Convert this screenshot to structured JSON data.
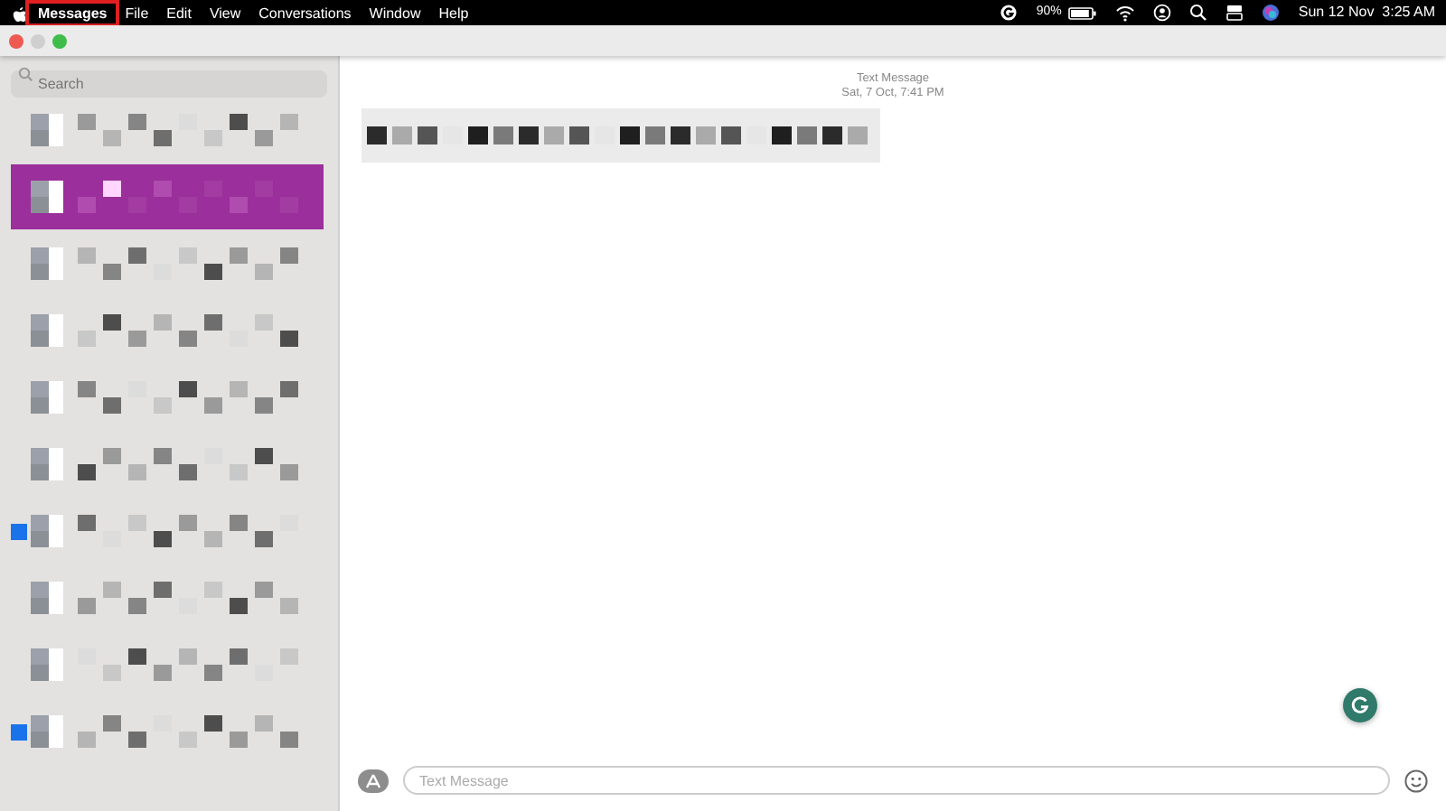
{
  "menu_bar": {
    "app_menus": [
      {
        "label": "Messages",
        "highlighted": true
      },
      {
        "label": "File",
        "highlighted": false
      },
      {
        "label": "Edit",
        "highlighted": false
      },
      {
        "label": "View",
        "highlighted": false
      },
      {
        "label": "Conversations",
        "highlighted": false
      },
      {
        "label": "Window",
        "highlighted": false
      },
      {
        "label": "Help",
        "highlighted": false
      }
    ],
    "battery": {
      "reading": "90%",
      "level": 0.9
    },
    "clock": "Sun 12 Nov  3:25 AM"
  },
  "sidebar": {
    "search": {
      "placeholder": "Search"
    },
    "conversations": [
      {
        "selected": false,
        "unread": false
      },
      {
        "selected": true,
        "unread": false
      },
      {
        "selected": false,
        "unread": false
      },
      {
        "selected": false,
        "unread": false
      },
      {
        "selected": false,
        "unread": false
      },
      {
        "selected": false,
        "unread": false
      },
      {
        "selected": false,
        "unread": true
      },
      {
        "selected": false,
        "unread": false
      },
      {
        "selected": false,
        "unread": false
      },
      {
        "selected": false,
        "unread": true
      }
    ]
  },
  "chat": {
    "header": {
      "service": "Text Message",
      "timestamp": "Sat, 7 Oct, 7:41 PM"
    },
    "composer": {
      "placeholder": "Text Message"
    }
  }
}
